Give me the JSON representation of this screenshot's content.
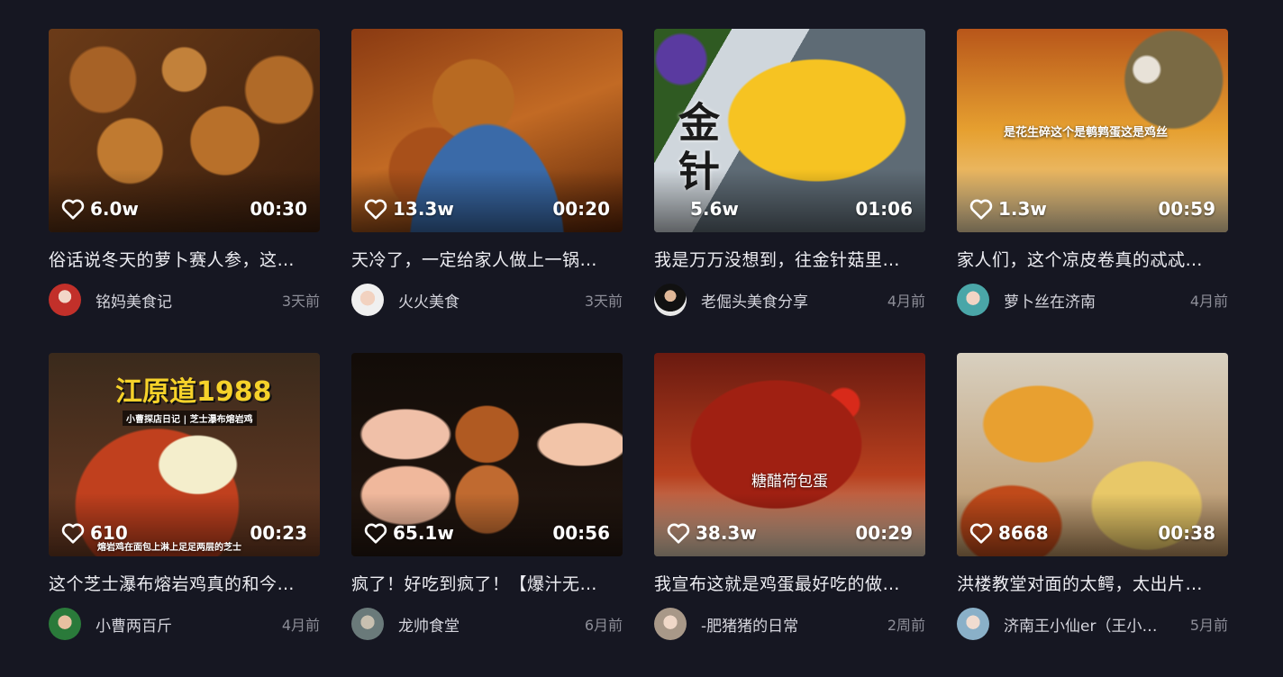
{
  "cards": [
    {
      "likes": "6.0w",
      "duration": "00:30",
      "title": "俗话说冬天的萝卜赛人参，这…",
      "author": "铭妈美食记",
      "time": "3天前",
      "overlay": ""
    },
    {
      "likes": "13.3w",
      "duration": "00:20",
      "title": "天冷了，一定给家人做上一锅…",
      "author": "火火美食",
      "time": "3天前",
      "overlay": ""
    },
    {
      "likes": "5.6w",
      "duration": "01:06",
      "title": "我是万万没想到，往金针菇里…",
      "author": "老倔头美食分享",
      "time": "4月前",
      "overlay": "金针"
    },
    {
      "likes": "1.3w",
      "duration": "00:59",
      "title": "家人们，这个凉皮卷真的忒忒…",
      "author": "萝卜丝在济南",
      "time": "4月前",
      "overlay": "是花生碎这个是鹌鹑蛋这是鸡丝"
    },
    {
      "likes": "610",
      "duration": "00:23",
      "title": "这个芝士瀑布熔岩鸡真的和今…",
      "author": "小曹两百斤",
      "time": "4月前",
      "overlay": "江原道1988",
      "overlay2": "小曹探店日记 | 芝士瀑布熔岩鸡",
      "overlay3": "熔岩鸡在面包上淋上足足两层的芝士"
    },
    {
      "likes": "65.1w",
      "duration": "00:56",
      "title": "疯了！好吃到疯了！【爆汁无…",
      "author": "龙帅食堂",
      "time": "6月前",
      "overlay": ""
    },
    {
      "likes": "38.3w",
      "duration": "00:29",
      "title": "我宣布这就是鸡蛋最好吃的做…",
      "author": "-肥猪猪的日常",
      "time": "2周前",
      "overlay": "糖醋荷包蛋"
    },
    {
      "likes": "8668",
      "duration": "00:38",
      "title": "洪楼教堂对面的太鳄，太出片…",
      "author": "济南王小仙er（王小桐…",
      "time": "5月前",
      "overlay": ""
    }
  ]
}
